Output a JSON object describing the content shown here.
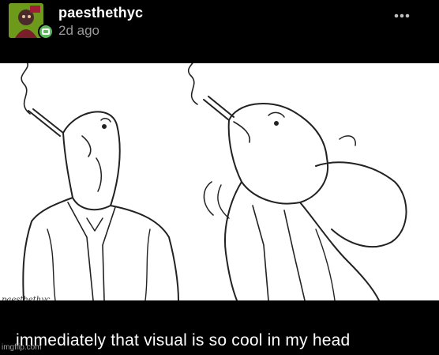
{
  "post": {
    "username": "paesthethyc",
    "timestamp": "2d ago"
  },
  "icons": {
    "more": "more-options-icon",
    "badge": "status-badge-icon"
  },
  "artwork": {
    "signature": "paesthethyc"
  },
  "caption": "immediately that visual is so cool in my head",
  "watermark": "imgflip.com",
  "colors": {
    "background": "#000000",
    "username": "#ffffff",
    "timestamp": "#9a9a9a",
    "avatar": "#6e9a1c",
    "badge": "#5bb85c"
  }
}
